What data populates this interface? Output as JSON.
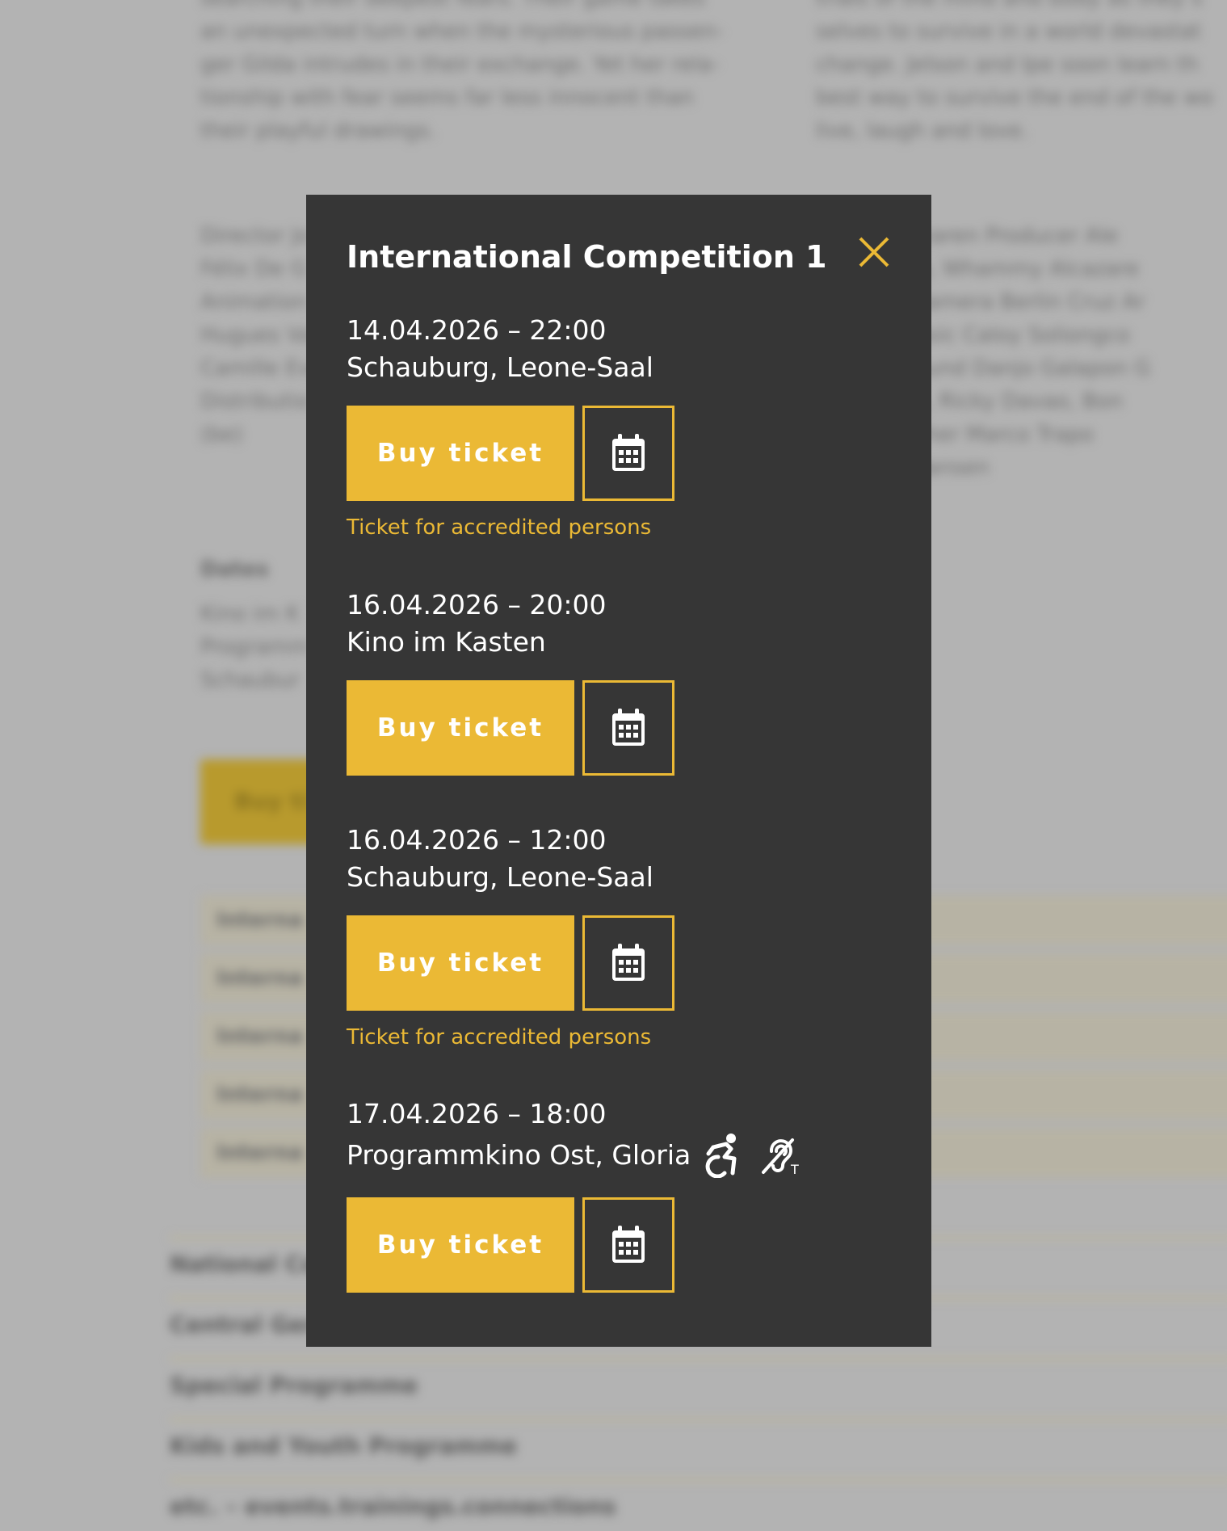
{
  "background": {
    "left_text": [
      "searching their deepest fears. Their game takes",
      "an unexpected turn when the mysterious passen-",
      "ger Gilda intrudes in their exchange. Yet her rela-",
      "tionship with fear seems far less innocent than",
      "their playful drawings."
    ],
    "right_text": [
      "trials of the mind and body as they s",
      "selves to survive in a world devastat",
      "change. Jelson and Ipe soon learn th",
      "best way to survive the end of the wo",
      "live, laugh and love."
    ],
    "credits_left": [
      "Director Jo",
      "Félix De G",
      "Animation",
      "Hugues Va",
      "Camille Eve",
      "Distributio",
      "(be)"
    ],
    "credits_right": [
      "mmy Alcazaren Producer Ale",
      "a Bernaldo, Whammy Alcazare",
      "lcazaren Camera Berlin Cruz Ar",
      "eranan Music Caloy Soliongco",
      "ndaTTT Sound Danjo Galapon G",
      "Nerizjanes, Ricky Davao, Bon",
      "photographer Marco Trapo",
      "s, Rhodel Jansen"
    ],
    "dates_title": "Dates",
    "dates": [
      "Kino im K",
      "Programm",
      "Schaubur"
    ],
    "buy_label": "Buy ti",
    "rows": [
      "Interna",
      "Interna",
      "Interna",
      "Interna",
      "Interna"
    ],
    "accordion": [
      "National Co",
      "Central Ger",
      "Special Programme",
      "Kids and Youth Programme",
      "etc. – events.trainings.connections"
    ]
  },
  "modal": {
    "title": "International Competition 1",
    "screenings": [
      {
        "datetime": "14.04.2026 – 22:00",
        "venue": "Schauburg, Leone-Saal",
        "buy_label": "Buy ticket",
        "note": "Ticket for accredited persons"
      },
      {
        "datetime": "16.04.2026 – 20:00",
        "venue": "Kino im Kasten",
        "buy_label": "Buy ticket",
        "note": ""
      },
      {
        "datetime": "16.04.2026 – 12:00",
        "venue": "Schauburg, Leone-Saal",
        "buy_label": "Buy ticket",
        "note": "Ticket for accredited persons"
      },
      {
        "datetime": "17.04.2026 – 18:00",
        "venue": "Programmkino Ost, Gloria",
        "buy_label": "Buy ticket",
        "note": "",
        "accessibility_icons": [
          "wheelchair-icon",
          "hearing-loop-icon"
        ]
      }
    ]
  },
  "colors": {
    "accent": "#ebb935",
    "modal_bg": "#363636",
    "backdrop": "#b3b3b3"
  }
}
